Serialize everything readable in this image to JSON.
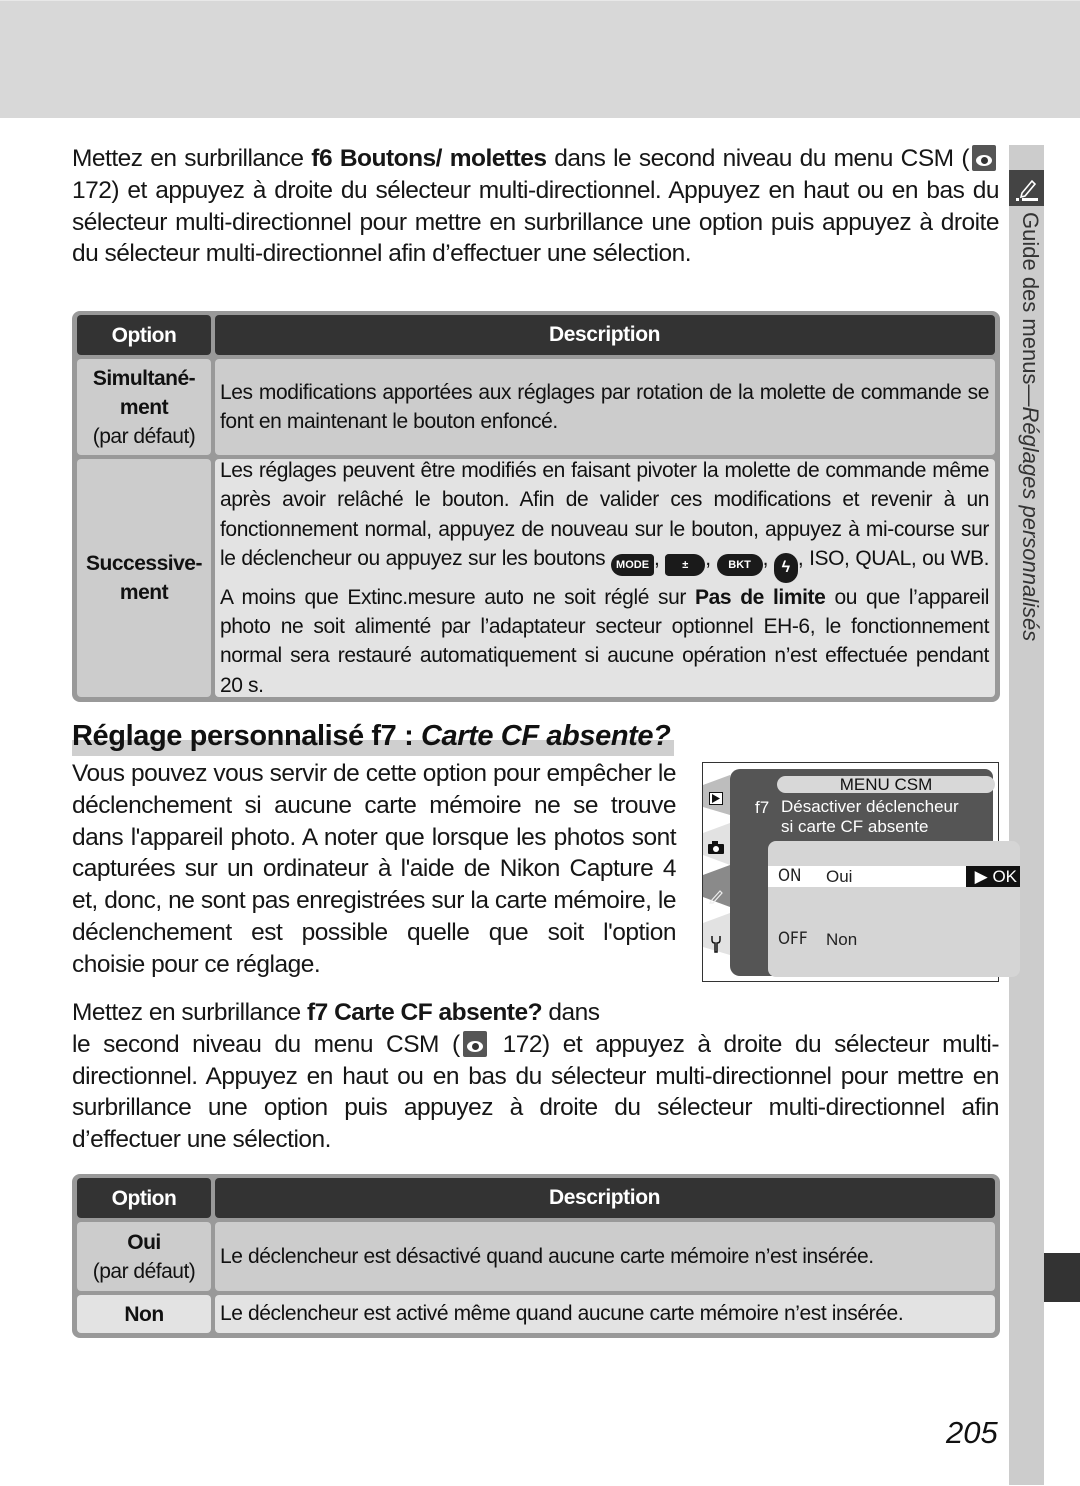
{
  "side_tab": {
    "icon": "pencil-icon",
    "label_prefix": "Guide des menus",
    "label_dash": "—",
    "label_section": "Réglages personnalisés"
  },
  "intro": {
    "t1": "Mettez en surbrillance ",
    "bold": "f6 Boutons/ molettes",
    "t2": " dans le second niveau du menu CSM (",
    "ref_icon": "page-reference-icon",
    "t3": " 172) et appuyez à droite du sélecteur multi-directionnel. Appuyez en haut ou en bas du sélecteur multi-directionnel pour mettre en surbrillance une option puis appuyez à droite du sélecteur multi-directionnel afin d’effectuer une sélection."
  },
  "table1": {
    "header_option": "Option",
    "header_description": "Description",
    "rows": [
      {
        "option": "Simultané-",
        "option2": "ment",
        "note": "(par défaut)",
        "description": "Les modifications apportées aux réglages par rotation de la molette de commande se font en maintenant le bouton enfoncé."
      },
      {
        "option": "Successive-",
        "option2": "ment",
        "d1": "Les réglages peuvent être modifiés en faisant pivoter la molette de commande même après avoir relâché le bouton. Afin de valider ces modifications et revenir à un fonctionnement normal, appuyez de nouveau sur le bouton, appuyez à mi-course sur le déclencheur ou appuyez sur les boutons ",
        "btn_mode": "MODE",
        "btn_exp": "±",
        "btn_bkt": "BKT",
        "btn_flash": "ϟ",
        "sep": ", ",
        "d2": ", ISO, QUAL, ou WB. A moins que Extinc.mesure auto ne soit réglé sur ",
        "bold": "Pas de limite",
        "d3": " ou que l’appareil photo ne soit alimenté par l’adaptateur secteur optionnel EH-6, le fonctionnement normal sera restauré automatiquement si aucune opération n’est effectuée pendant 20 s."
      }
    ]
  },
  "section": {
    "heading_plain": "Réglage personnalisé f7 : ",
    "heading_italic": "Carte CF absente?",
    "body": "Vous pouvez vous servir de cette option pour empêcher le déclenchement si aucune carte mémoire ne se trouve dans l'appareil photo. A noter que lorsque les photos sont capturées sur un ordinateur à l'aide de Nikon Capture 4 et, donc, ne sont pas enregistrées sur la carte mémoire, le déclenchement est possible quelle que soit l'option choisie pour ce réglage."
  },
  "camera_screen": {
    "title": "MENU CSM",
    "item_code": "f7",
    "item_line1": "Désactiver déclencheur",
    "item_line2": "si carte CF absente",
    "options": [
      {
        "key": "ON",
        "label": "Oui",
        "selected": true,
        "confirm": "▶ OK"
      },
      {
        "key": "OFF",
        "label": "Non",
        "selected": false
      }
    ],
    "tabs": [
      "playback-icon",
      "camera-icon",
      "pencil-icon",
      "wrench-icon"
    ]
  },
  "para2": {
    "t1": "Mettez en surbrillance ",
    "bold": "f7 Carte CF absente?",
    "t2": " dans",
    "t3": "le second niveau du menu CSM (",
    "t4": " 172) et appuyez à droite du sélecteur multi-directionnel. Appuyez en haut ou en bas du sélecteur multi-directionnel pour mettre en surbrillance une option puis appuyez à droite du sélecteur multi-directionnel afin d’effectuer une sélection."
  },
  "table2": {
    "header_option": "Option",
    "header_description": "Description",
    "rows": [
      {
        "option": "Oui",
        "note": "(par défaut)",
        "description": "Le déclencheur est désactivé quand aucune carte mémoire n’est insérée."
      },
      {
        "option": "Non",
        "description": "Le déclencheur est activé même quand aucune carte mémoire n’est insérée."
      }
    ]
  },
  "page_number": "205"
}
